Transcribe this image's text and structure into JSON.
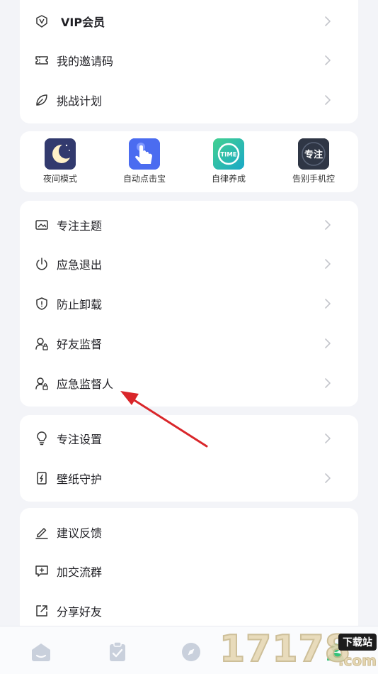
{
  "section1": {
    "items": [
      {
        "label": "VIP会员",
        "icon": "vip-shield-icon"
      },
      {
        "label": "我的邀请码",
        "icon": "ticket-icon"
      },
      {
        "label": "挑战计划",
        "icon": "leaf-icon"
      }
    ]
  },
  "apps": [
    {
      "label": "夜间模式",
      "icon": "moon-icon"
    },
    {
      "label": "自动点击宝",
      "icon": "tap-hand-icon"
    },
    {
      "label": "自律养成",
      "icon": "time-icon",
      "badge_text": "TIME"
    },
    {
      "label": "告别手机控",
      "icon": "focus-badge-icon",
      "badge_text": "专注"
    }
  ],
  "section2": {
    "items": [
      {
        "label": "专注主题",
        "icon": "image-icon"
      },
      {
        "label": "应急退出",
        "icon": "power-icon"
      },
      {
        "label": "防止卸载",
        "icon": "shield-icon"
      },
      {
        "label": "好友监督",
        "icon": "user-lock-icon"
      },
      {
        "label": "应急监督人",
        "icon": "user-lock-icon"
      }
    ]
  },
  "section3": {
    "items": [
      {
        "label": "专注设置",
        "icon": "bulb-icon"
      },
      {
        "label": "壁纸守护",
        "icon": "phone-bolt-icon"
      }
    ]
  },
  "section4": {
    "items": [
      {
        "label": "建议反馈",
        "icon": "pencil-icon"
      },
      {
        "label": "加交流群",
        "icon": "chat-plus-icon"
      },
      {
        "label": "分享好友",
        "icon": "share-icon"
      }
    ]
  },
  "tabbar": {
    "tabs": [
      {
        "icon": "home-icon"
      },
      {
        "icon": "clipboard-icon"
      },
      {
        "icon": "compass-icon"
      },
      {
        "icon": "profile-icon"
      }
    ]
  },
  "watermark": {
    "digits": "17178",
    "badge": "下载站",
    "domain": ".com"
  },
  "colors": {
    "background": "#f3f4f8",
    "card": "#ffffff",
    "chevron": "#c4c6cc",
    "arrow": "#d9262a",
    "tab_icon": "#c9d0dc"
  }
}
